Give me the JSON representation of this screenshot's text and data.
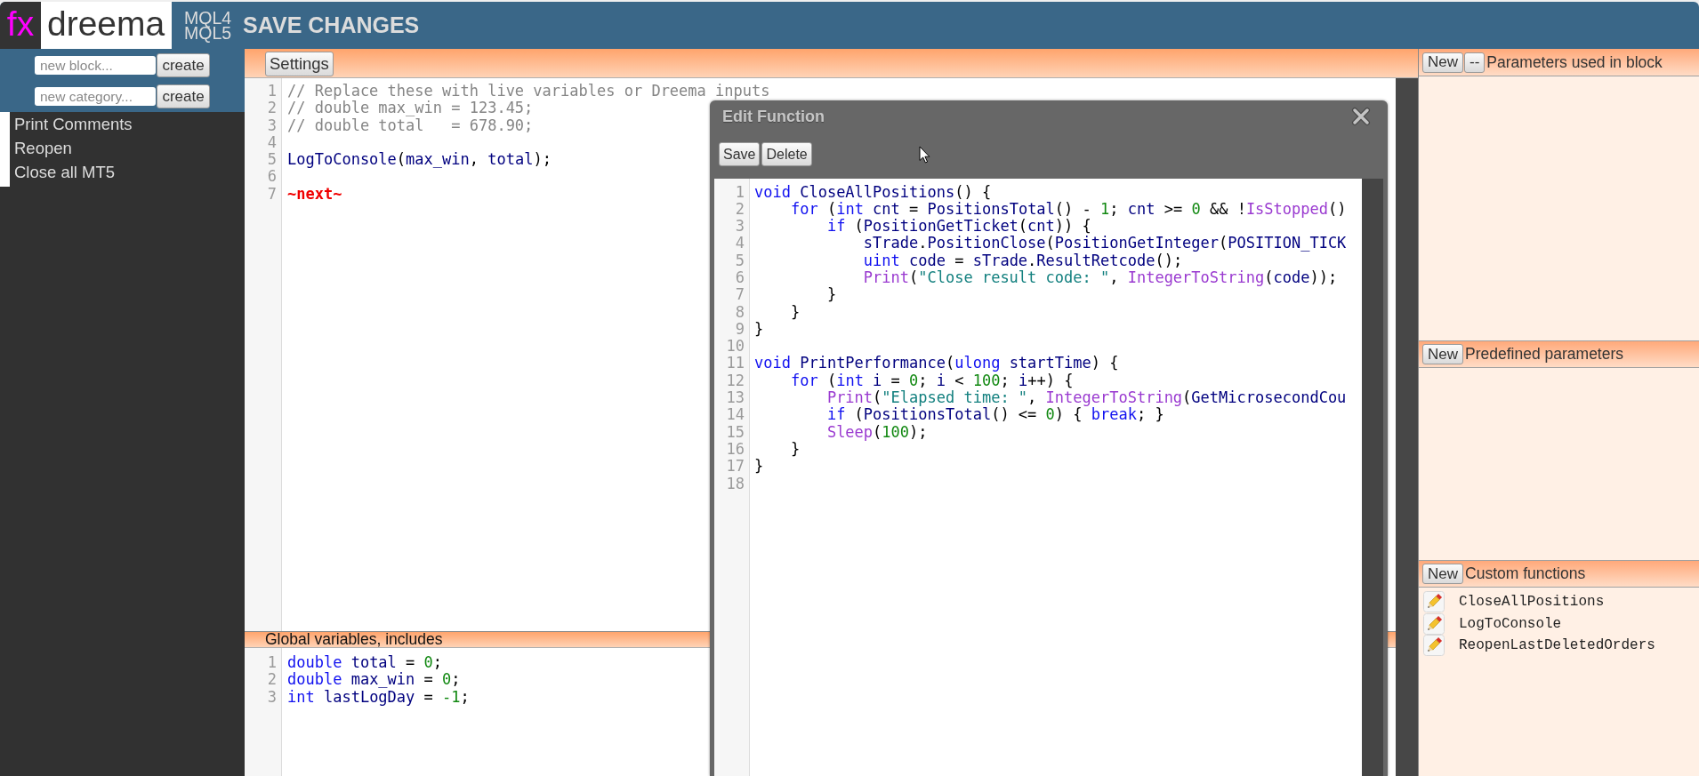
{
  "header": {
    "logo": {
      "prefix": "fx",
      "name": "dreema"
    },
    "languages": [
      "MQL4",
      "MQL5"
    ],
    "save_action": "SAVE CHANGES"
  },
  "sidebar": {
    "create_rows": [
      {
        "placeholder": "new block...",
        "button": "create"
      },
      {
        "placeholder": "new category...",
        "button": "create"
      }
    ],
    "items": [
      {
        "label": "Print Comments"
      },
      {
        "label": "Reopen"
      },
      {
        "label": "Close all MT5"
      }
    ]
  },
  "block_editor": {
    "settings_button": "Settings",
    "lines": [
      {
        "number": "1",
        "tokens": [
          {
            "kind": "comment",
            "text": "// Replace these with live variables or Dreema inputs"
          }
        ]
      },
      {
        "number": "2",
        "tokens": [
          {
            "kind": "comment",
            "text": "// double max_win = 123.45;"
          }
        ]
      },
      {
        "number": "3",
        "tokens": [
          {
            "kind": "comment",
            "text": "// double total   = 678.90;"
          }
        ]
      },
      {
        "number": "4"
      },
      {
        "number": "5",
        "tokens": [
          {
            "kind": "identifier",
            "text": "LogToConsole"
          },
          {
            "kind": "punct",
            "text": "("
          },
          {
            "kind": "identifier",
            "text": "max_win"
          },
          {
            "kind": "punct",
            "text": ", "
          },
          {
            "kind": "identifier",
            "text": "total"
          },
          {
            "kind": "punct",
            "text": ");"
          }
        ]
      },
      {
        "number": "6"
      },
      {
        "number": "7",
        "tokens": [
          {
            "kind": "marker",
            "text": "~next~"
          }
        ]
      }
    ]
  },
  "globals": {
    "title": "Global variables, includes",
    "lines": [
      {
        "number": "1",
        "tokens": [
          {
            "kind": "keyword",
            "text": "double "
          },
          {
            "kind": "identifier",
            "text": "total "
          },
          {
            "kind": "punct",
            "text": "= "
          },
          {
            "kind": "number",
            "text": "0"
          },
          {
            "kind": "punct",
            "text": ";"
          }
        ]
      },
      {
        "number": "2",
        "tokens": [
          {
            "kind": "keyword",
            "text": "double "
          },
          {
            "kind": "identifier",
            "text": "max_win "
          },
          {
            "kind": "punct",
            "text": "= "
          },
          {
            "kind": "number",
            "text": "0"
          },
          {
            "kind": "punct",
            "text": ";"
          }
        ]
      },
      {
        "number": "3",
        "tokens": [
          {
            "kind": "keyword",
            "text": "int "
          },
          {
            "kind": "identifier",
            "text": "lastLogDay "
          },
          {
            "kind": "punct",
            "text": "= "
          },
          {
            "kind": "number",
            "text": "-1"
          },
          {
            "kind": "punct",
            "text": ";"
          }
        ]
      }
    ]
  },
  "right_panel": {
    "sections": [
      {
        "buttons": [
          "New",
          "--"
        ],
        "title": "Parameters used in block"
      },
      {
        "buttons": [
          "New"
        ],
        "title": "Predefined parameters"
      },
      {
        "buttons": [
          "New"
        ],
        "title": "Custom functions",
        "items": [
          "CloseAllPositions",
          "LogToConsole",
          "ReopenLastDeletedOrders"
        ]
      }
    ]
  },
  "dialog": {
    "title": "Edit Function",
    "buttons": [
      "Save",
      "Delete"
    ],
    "lines": [
      {
        "number": "1",
        "tokens": [
          {
            "kind": "keyword",
            "text": "void "
          },
          {
            "kind": "identifier",
            "text": "CloseAllPositions"
          },
          {
            "kind": "punct",
            "text": "() {"
          }
        ]
      },
      {
        "number": "2",
        "tokens": [
          {
            "kind": "keyword",
            "text": "    for "
          },
          {
            "kind": "punct",
            "text": "("
          },
          {
            "kind": "keyword",
            "text": "int "
          },
          {
            "kind": "identifier",
            "text": "cnt "
          },
          {
            "kind": "punct",
            "text": "= "
          },
          {
            "kind": "identifier",
            "text": "PositionsTotal"
          },
          {
            "kind": "punct",
            "text": "() - "
          },
          {
            "kind": "number",
            "text": "1"
          },
          {
            "kind": "punct",
            "text": "; "
          },
          {
            "kind": "identifier",
            "text": "cnt "
          },
          {
            "kind": "punct",
            "text": ">= "
          },
          {
            "kind": "number",
            "text": "0 "
          },
          {
            "kind": "punct",
            "text": "&& !"
          },
          {
            "kind": "builtin",
            "text": "IsStopped"
          },
          {
            "kind": "punct",
            "text": "()"
          }
        ]
      },
      {
        "number": "3",
        "tokens": [
          {
            "kind": "keyword",
            "text": "        if "
          },
          {
            "kind": "punct",
            "text": "("
          },
          {
            "kind": "identifier",
            "text": "PositionGetTicket"
          },
          {
            "kind": "punct",
            "text": "("
          },
          {
            "kind": "identifier",
            "text": "cnt"
          },
          {
            "kind": "punct",
            "text": ")) {"
          }
        ]
      },
      {
        "number": "4",
        "tokens": [
          {
            "kind": "identifier",
            "text": "            sTrade"
          },
          {
            "kind": "punct",
            "text": "."
          },
          {
            "kind": "identifier",
            "text": "PositionClose"
          },
          {
            "kind": "punct",
            "text": "("
          },
          {
            "kind": "identifier",
            "text": "PositionGetInteger"
          },
          {
            "kind": "punct",
            "text": "("
          },
          {
            "kind": "identifier",
            "text": "POSITION_TICK"
          }
        ]
      },
      {
        "number": "5",
        "tokens": [
          {
            "kind": "keyword",
            "text": "            uint "
          },
          {
            "kind": "identifier",
            "text": "code "
          },
          {
            "kind": "punct",
            "text": "= "
          },
          {
            "kind": "identifier",
            "text": "sTrade"
          },
          {
            "kind": "punct",
            "text": "."
          },
          {
            "kind": "identifier",
            "text": "ResultRetcode"
          },
          {
            "kind": "punct",
            "text": "();"
          }
        ]
      },
      {
        "number": "6",
        "tokens": [
          {
            "kind": "builtin",
            "text": "            Print"
          },
          {
            "kind": "punct",
            "text": "("
          },
          {
            "kind": "string",
            "text": "\"Close result code: \""
          },
          {
            "kind": "punct",
            "text": ", "
          },
          {
            "kind": "builtin",
            "text": "IntegerToString"
          },
          {
            "kind": "punct",
            "text": "("
          },
          {
            "kind": "identifier",
            "text": "code"
          },
          {
            "kind": "punct",
            "text": "));"
          }
        ]
      },
      {
        "number": "7",
        "tokens": [
          {
            "kind": "punct",
            "text": "        }"
          }
        ]
      },
      {
        "number": "8",
        "tokens": [
          {
            "kind": "punct",
            "text": "    }"
          }
        ]
      },
      {
        "number": "9",
        "tokens": [
          {
            "kind": "punct",
            "text": "}"
          }
        ]
      },
      {
        "number": "10"
      },
      {
        "number": "11",
        "tokens": [
          {
            "kind": "keyword",
            "text": "void "
          },
          {
            "kind": "identifier",
            "text": "PrintPerformance"
          },
          {
            "kind": "punct",
            "text": "("
          },
          {
            "kind": "keyword",
            "text": "ulong "
          },
          {
            "kind": "identifier",
            "text": "startTime"
          },
          {
            "kind": "punct",
            "text": ") {"
          }
        ]
      },
      {
        "number": "12",
        "tokens": [
          {
            "kind": "keyword",
            "text": "    for "
          },
          {
            "kind": "punct",
            "text": "("
          },
          {
            "kind": "keyword",
            "text": "int "
          },
          {
            "kind": "identifier",
            "text": "i "
          },
          {
            "kind": "punct",
            "text": "= "
          },
          {
            "kind": "number",
            "text": "0"
          },
          {
            "kind": "punct",
            "text": "; "
          },
          {
            "kind": "identifier",
            "text": "i "
          },
          {
            "kind": "punct",
            "text": "< "
          },
          {
            "kind": "number",
            "text": "100"
          },
          {
            "kind": "punct",
            "text": "; "
          },
          {
            "kind": "identifier",
            "text": "i"
          },
          {
            "kind": "punct",
            "text": "++) {"
          }
        ]
      },
      {
        "number": "13",
        "tokens": [
          {
            "kind": "builtin",
            "text": "        Print"
          },
          {
            "kind": "punct",
            "text": "("
          },
          {
            "kind": "string",
            "text": "\"Elapsed time: \""
          },
          {
            "kind": "punct",
            "text": ", "
          },
          {
            "kind": "builtin",
            "text": "IntegerToString"
          },
          {
            "kind": "punct",
            "text": "("
          },
          {
            "kind": "identifier",
            "text": "GetMicrosecondCou"
          }
        ]
      },
      {
        "number": "14",
        "tokens": [
          {
            "kind": "keyword",
            "text": "        if "
          },
          {
            "kind": "punct",
            "text": "("
          },
          {
            "kind": "identifier",
            "text": "PositionsTotal"
          },
          {
            "kind": "punct",
            "text": "() <= "
          },
          {
            "kind": "number",
            "text": "0"
          },
          {
            "kind": "punct",
            "text": ") { "
          },
          {
            "kind": "keyword",
            "text": "break"
          },
          {
            "kind": "punct",
            "text": "; }"
          }
        ]
      },
      {
        "number": "15",
        "tokens": [
          {
            "kind": "builtin",
            "text": "        Sleep"
          },
          {
            "kind": "punct",
            "text": "("
          },
          {
            "kind": "number",
            "text": "100"
          },
          {
            "kind": "punct",
            "text": ");"
          }
        ]
      },
      {
        "number": "16",
        "tokens": [
          {
            "kind": "punct",
            "text": "    }"
          }
        ]
      },
      {
        "number": "17",
        "tokens": [
          {
            "kind": "punct",
            "text": "}"
          }
        ]
      },
      {
        "number": "18"
      }
    ]
  }
}
